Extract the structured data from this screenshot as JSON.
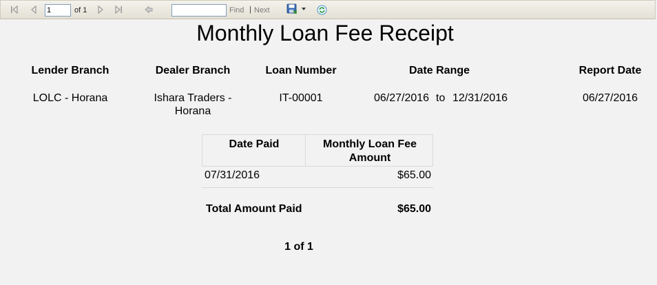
{
  "toolbar": {
    "current_page": "1",
    "of_pages": "of 1",
    "find_value": "",
    "find_label": "Find",
    "separator": "|",
    "next_label": "Next"
  },
  "report": {
    "title": "Monthly Loan Fee Receipt",
    "headers": {
      "lender_branch": "Lender Branch",
      "dealer_branch": "Dealer Branch",
      "loan_number": "Loan Number",
      "date_range": "Date Range",
      "report_date": "Report Date"
    },
    "values": {
      "lender_branch": "LOLC - Horana",
      "dealer_branch_line1": "Ishara Traders -",
      "dealer_branch_line2": "Horana",
      "loan_number": "IT-00001",
      "date_from": "06/27/2016",
      "date_to_word": "to",
      "date_to": "12/31/2016",
      "report_date": "06/27/2016"
    },
    "table": {
      "col_date_paid": "Date Paid",
      "col_amount_line1": "Monthly Loan Fee",
      "col_amount_line2": "Amount",
      "rows": [
        {
          "date_paid": "07/31/2016",
          "amount": "$65.00"
        }
      ],
      "total_label": "Total Amount Paid",
      "total_value": "$65.00"
    },
    "page_indicator": "1 of 1"
  }
}
